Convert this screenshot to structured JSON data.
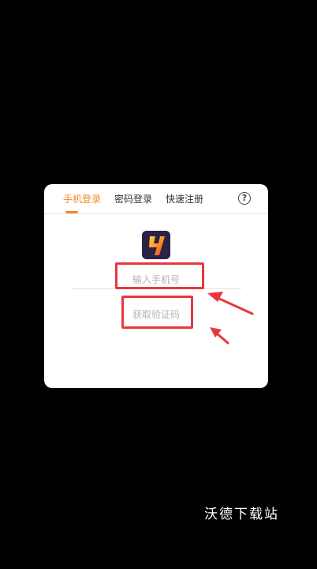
{
  "login_dialog": {
    "tabs": [
      {
        "label": "手机登录",
        "active": true
      },
      {
        "label": "密码登录",
        "active": false
      },
      {
        "label": "快速注册",
        "active": false
      }
    ],
    "help_icon": "question-circle-icon",
    "app_logo_icon": "lightning-app-icon",
    "phone_field": {
      "placeholder": "输入手机号",
      "value": ""
    },
    "get_code_label": "获取验证码"
  },
  "colors": {
    "accent": "#f08a2a",
    "annotation_red": "#e8383d",
    "placeholder_gray": "#b3b3b3",
    "logo_bg": "#2b2346"
  },
  "watermark": "沃德下载站"
}
